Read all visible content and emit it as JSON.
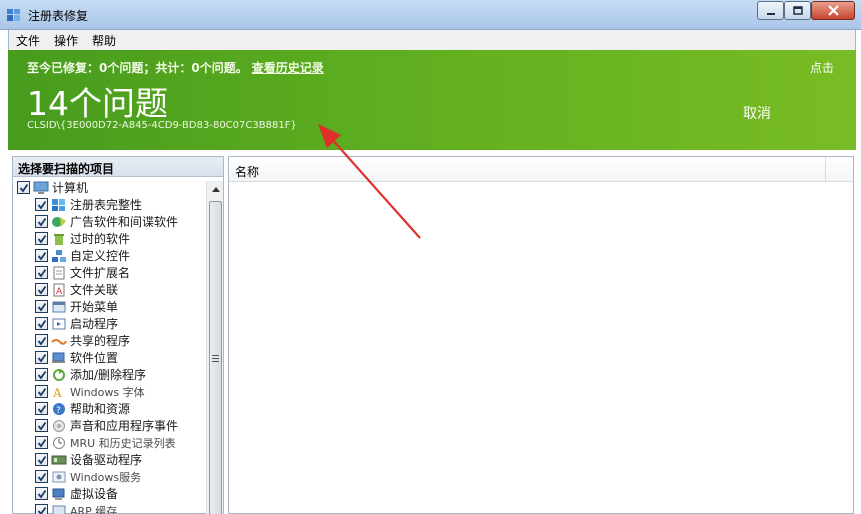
{
  "window": {
    "title": "注册表修复"
  },
  "menu": [
    {
      "label": "文件"
    },
    {
      "label": "操作"
    },
    {
      "label": "帮助"
    }
  ],
  "header": {
    "summary": "至今已修复：0个问题；共计：0个问题。",
    "history_link": "查看历史记录",
    "scan_link": "点击",
    "issue_count": "14个问题",
    "cancel": "取消",
    "clsid": "CLSID\\{3E000D72-A845-4CD9-BD83-80C07C3B881F}",
    "colors": {
      "gradient_start": "#479b1d",
      "gradient_end": "#79bc25"
    }
  },
  "left_panel": {
    "title": "选择要扫描的项目",
    "root": {
      "label": "计算机",
      "icon": "computer-icon",
      "checked": true
    },
    "items": [
      {
        "label": "注册表完整性",
        "icon": "registry-icon",
        "checked": true
      },
      {
        "label": "广告软件和间谍软件",
        "icon": "adware-icon",
        "checked": true
      },
      {
        "label": "过时的软件",
        "icon": "trash-icon",
        "checked": true
      },
      {
        "label": "自定义控件",
        "icon": "controls-icon",
        "checked": true
      },
      {
        "label": "文件扩展名",
        "icon": "file-ext-icon",
        "checked": true
      },
      {
        "label": "文件关联",
        "icon": "file-assoc-icon",
        "checked": true
      },
      {
        "label": "开始菜单",
        "icon": "start-menu-icon",
        "checked": true
      },
      {
        "label": "启动程序",
        "icon": "startup-icon",
        "checked": true
      },
      {
        "label": "共享的程序",
        "icon": "shared-icon",
        "checked": true
      },
      {
        "label": "软件位置",
        "icon": "software-location-icon",
        "checked": true
      },
      {
        "label": "添加/删除程序",
        "icon": "add-remove-icon",
        "checked": true
      },
      {
        "label": "Windows 字体",
        "icon": "font-icon",
        "checked": true
      },
      {
        "label": "帮助和资源",
        "icon": "help-icon",
        "checked": true
      },
      {
        "label": "声音和应用程序事件",
        "icon": "sound-icon",
        "checked": true
      },
      {
        "label": "MRU 和历史记录列表",
        "icon": "history-icon",
        "checked": true
      },
      {
        "label": "设备驱动程序",
        "icon": "driver-icon",
        "checked": true
      },
      {
        "label": "Windows服务",
        "icon": "services-icon",
        "checked": true
      },
      {
        "label": "虚拟设备",
        "icon": "virtual-device-icon",
        "checked": true
      },
      {
        "label": "ARP 缓存",
        "icon": "arp-icon",
        "checked": true
      }
    ]
  },
  "right_panel": {
    "column_name": "名称"
  }
}
